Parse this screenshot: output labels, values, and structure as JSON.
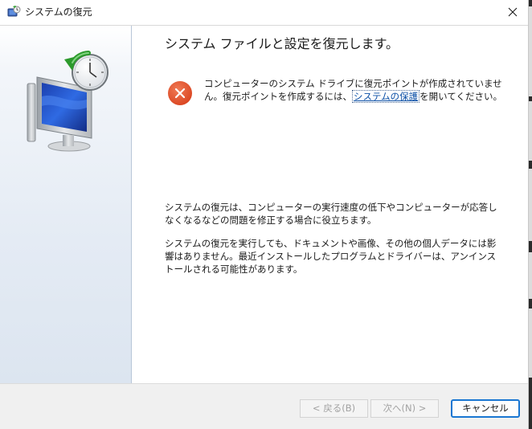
{
  "window": {
    "title": "システムの復元"
  },
  "main": {
    "heading": "システム ファイルと設定を復元します。",
    "error": {
      "text_before": "コンピューターのシステム ドライブに復元ポイントが作成されていません。復元ポイントを作成するには、",
      "link_text": "システムの保護",
      "text_after": "を開いてください。"
    },
    "info_paragraph_1": "システムの復元は、コンピューターの実行速度の低下やコンピューターが応答しなくなるなどの問題を修正する場合に役立ちます。",
    "info_paragraph_2": "システムの復元を実行しても、ドキュメントや画像、その他の個人データには影響はありません。最近インストールしたプログラムとドライバーは、アンインストールされる可能性があります。"
  },
  "footer": {
    "back_label": "< 戻る(B)",
    "next_label": "次へ(N) >",
    "cancel_label": "キャンセル"
  },
  "icons": {
    "app": "system-restore-icon",
    "hero": "system-restore-monitor-clock-icon",
    "error": "error-x-circle-icon",
    "close": "close-icon"
  },
  "colors": {
    "error_red": "#e2522f",
    "link_blue": "#0b4fa6",
    "focus_blue": "#1976d2",
    "footer_bg": "#f0f0f0"
  }
}
